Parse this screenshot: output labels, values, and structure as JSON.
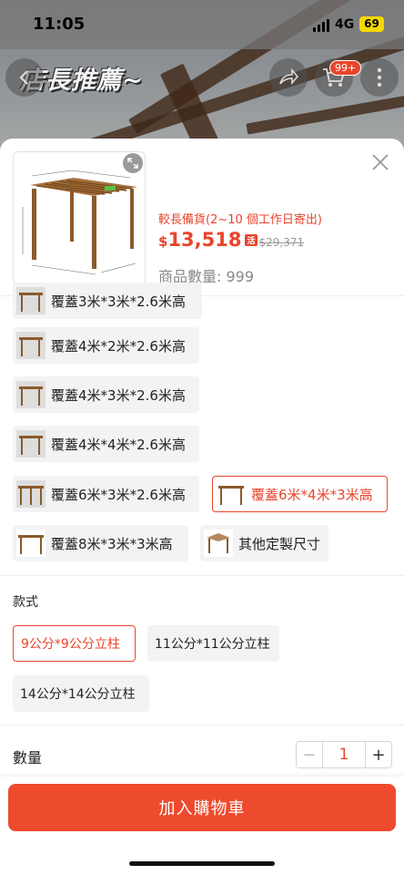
{
  "status_bar": {
    "time": "11:05",
    "network": "4G",
    "battery": "69"
  },
  "hero": {
    "title": "店長推薦~",
    "cart_badge": "99+"
  },
  "product": {
    "stock_note": "較長備貨(2~10 個工作日寄出)",
    "currency": "$",
    "price": "13,518",
    "price_tag": "活",
    "original_price": "$29,371",
    "quantity_available": "商品數量: 999"
  },
  "size_options": [
    {
      "label": "覆蓋3米*3米*2.6米高",
      "selected": false
    },
    {
      "label": "覆蓋4米*2米*2.6米高",
      "selected": false
    },
    {
      "label": "覆蓋4米*3米*2.6米高",
      "selected": false
    },
    {
      "label": "覆蓋4米*4米*2.6米高",
      "selected": false
    },
    {
      "label": "覆蓋6米*3米*2.6米高",
      "selected": false
    },
    {
      "label": "覆蓋6米*4米*3米高",
      "selected": true
    },
    {
      "label": "覆蓋8米*3米*3米高",
      "selected": false
    },
    {
      "label": "其他定製尺寸",
      "selected": false
    }
  ],
  "style": {
    "label": "款式",
    "options": [
      {
        "label": "9公分*9公分立柱",
        "selected": true
      },
      {
        "label": "11公分*11公分立柱",
        "selected": false
      },
      {
        "label": "14公分*14公分立柱",
        "selected": false
      }
    ]
  },
  "quantity": {
    "label": "數量",
    "value": "1",
    "minus": "−",
    "plus": "+"
  },
  "footer": {
    "add_to_cart": "加入購物車"
  },
  "colors": {
    "accent": "#e8452c",
    "button": "#ee4a2e",
    "wood": "#8a5a2b"
  }
}
